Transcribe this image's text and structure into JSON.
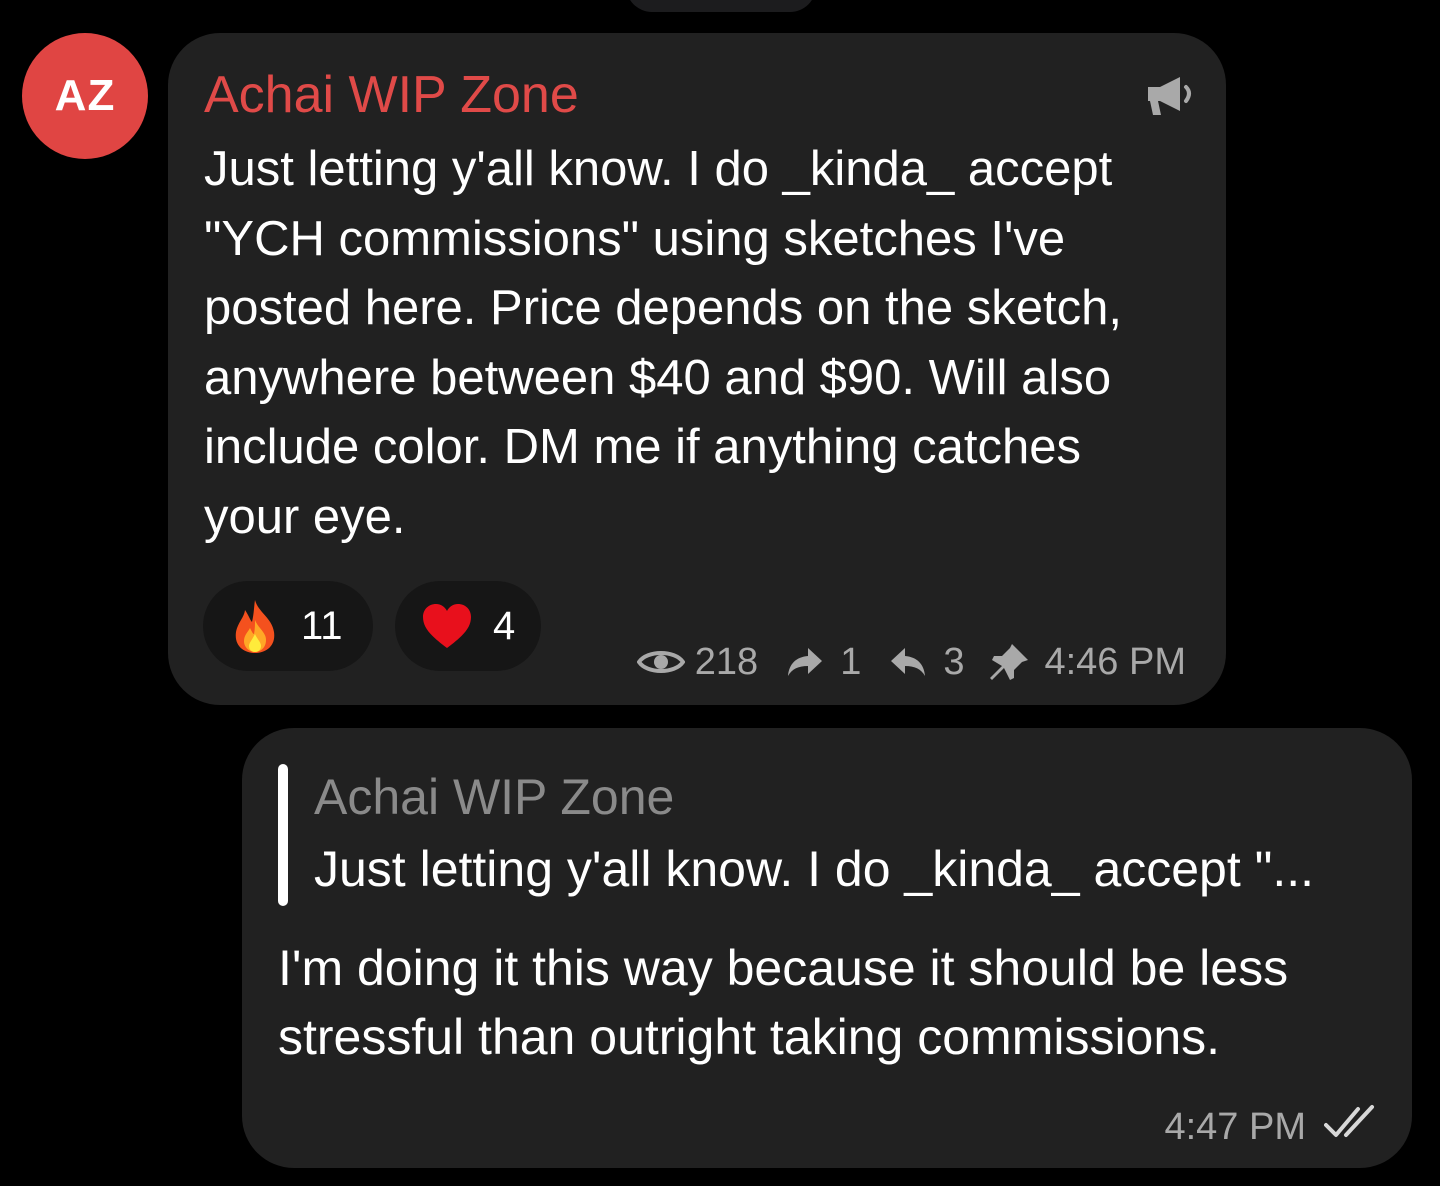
{
  "incoming": {
    "avatar_initials": "AZ",
    "avatar_color": "#e04543",
    "channel_name": "Achai WIP Zone",
    "channel_name_color": "#e04a48",
    "text": "Just letting y'all know. I do _kinda_ accept\n\"YCH commissions\" using sketches I've\nposted here. Price depends on the sketch,\nanywhere between $40 and $90. Will also\ninclude color. DM me if anything catches\nyour eye.",
    "reactions": [
      {
        "emoji": "fire",
        "count": "11"
      },
      {
        "emoji": "red-heart",
        "count": "4"
      }
    ],
    "views": "218",
    "forwards": "1",
    "replies": "3",
    "time": "4:46 PM",
    "icons": [
      "megaphone-icon",
      "eye-icon",
      "forward-icon",
      "reply-icon",
      "pin-icon"
    ]
  },
  "outgoing": {
    "quote_name": "Achai WIP Zone",
    "quote_text": "Just letting y'all know. I do _kinda_ accept \"...",
    "text": "I'm doing it this way because it should be less\nstressful than outright taking commissions.",
    "time": "4:47 PM",
    "status_icon": "double-check-icon"
  }
}
